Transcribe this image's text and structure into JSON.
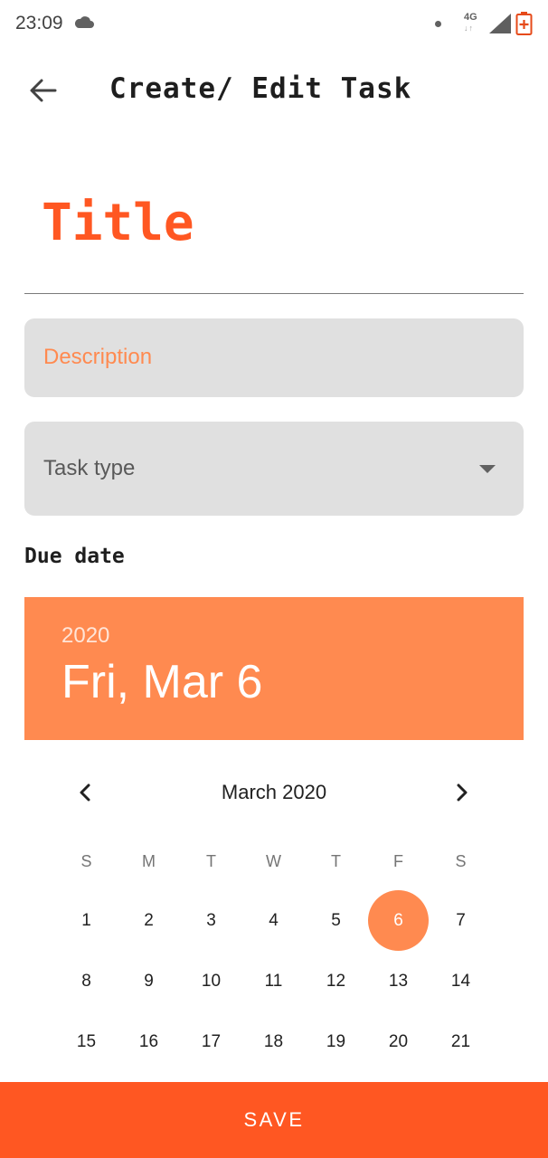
{
  "status_bar": {
    "time": "23:09",
    "network": "4G",
    "network_arrows": "↓↑",
    "icons": [
      "cloud-icon",
      "dot-icon",
      "signal-icon",
      "battery-charging-icon"
    ]
  },
  "header": {
    "title": "Create/ Edit Task",
    "back_icon": "arrow-left-icon"
  },
  "form": {
    "title_placeholder": "Title",
    "description_placeholder": "Description",
    "task_type_placeholder": "Task type",
    "due_date_label": "Due date"
  },
  "date_picker": {
    "year": "2020",
    "selected_date": "Fri, Mar 6",
    "month_label": "March 2020",
    "weekday_headers": [
      "S",
      "M",
      "T",
      "W",
      "T",
      "F",
      "S"
    ],
    "weeks": [
      [
        "1",
        "2",
        "3",
        "4",
        "5",
        "6",
        "7"
      ],
      [
        "8",
        "9",
        "10",
        "11",
        "12",
        "13",
        "14"
      ],
      [
        "15",
        "16",
        "17",
        "18",
        "19",
        "20",
        "21"
      ]
    ],
    "selected_day": "6"
  },
  "actions": {
    "save_label": "SAVE"
  },
  "colors": {
    "accent": "#ff5722",
    "accent_light": "#ff8a50",
    "field_bg": "#e0e0e0"
  }
}
